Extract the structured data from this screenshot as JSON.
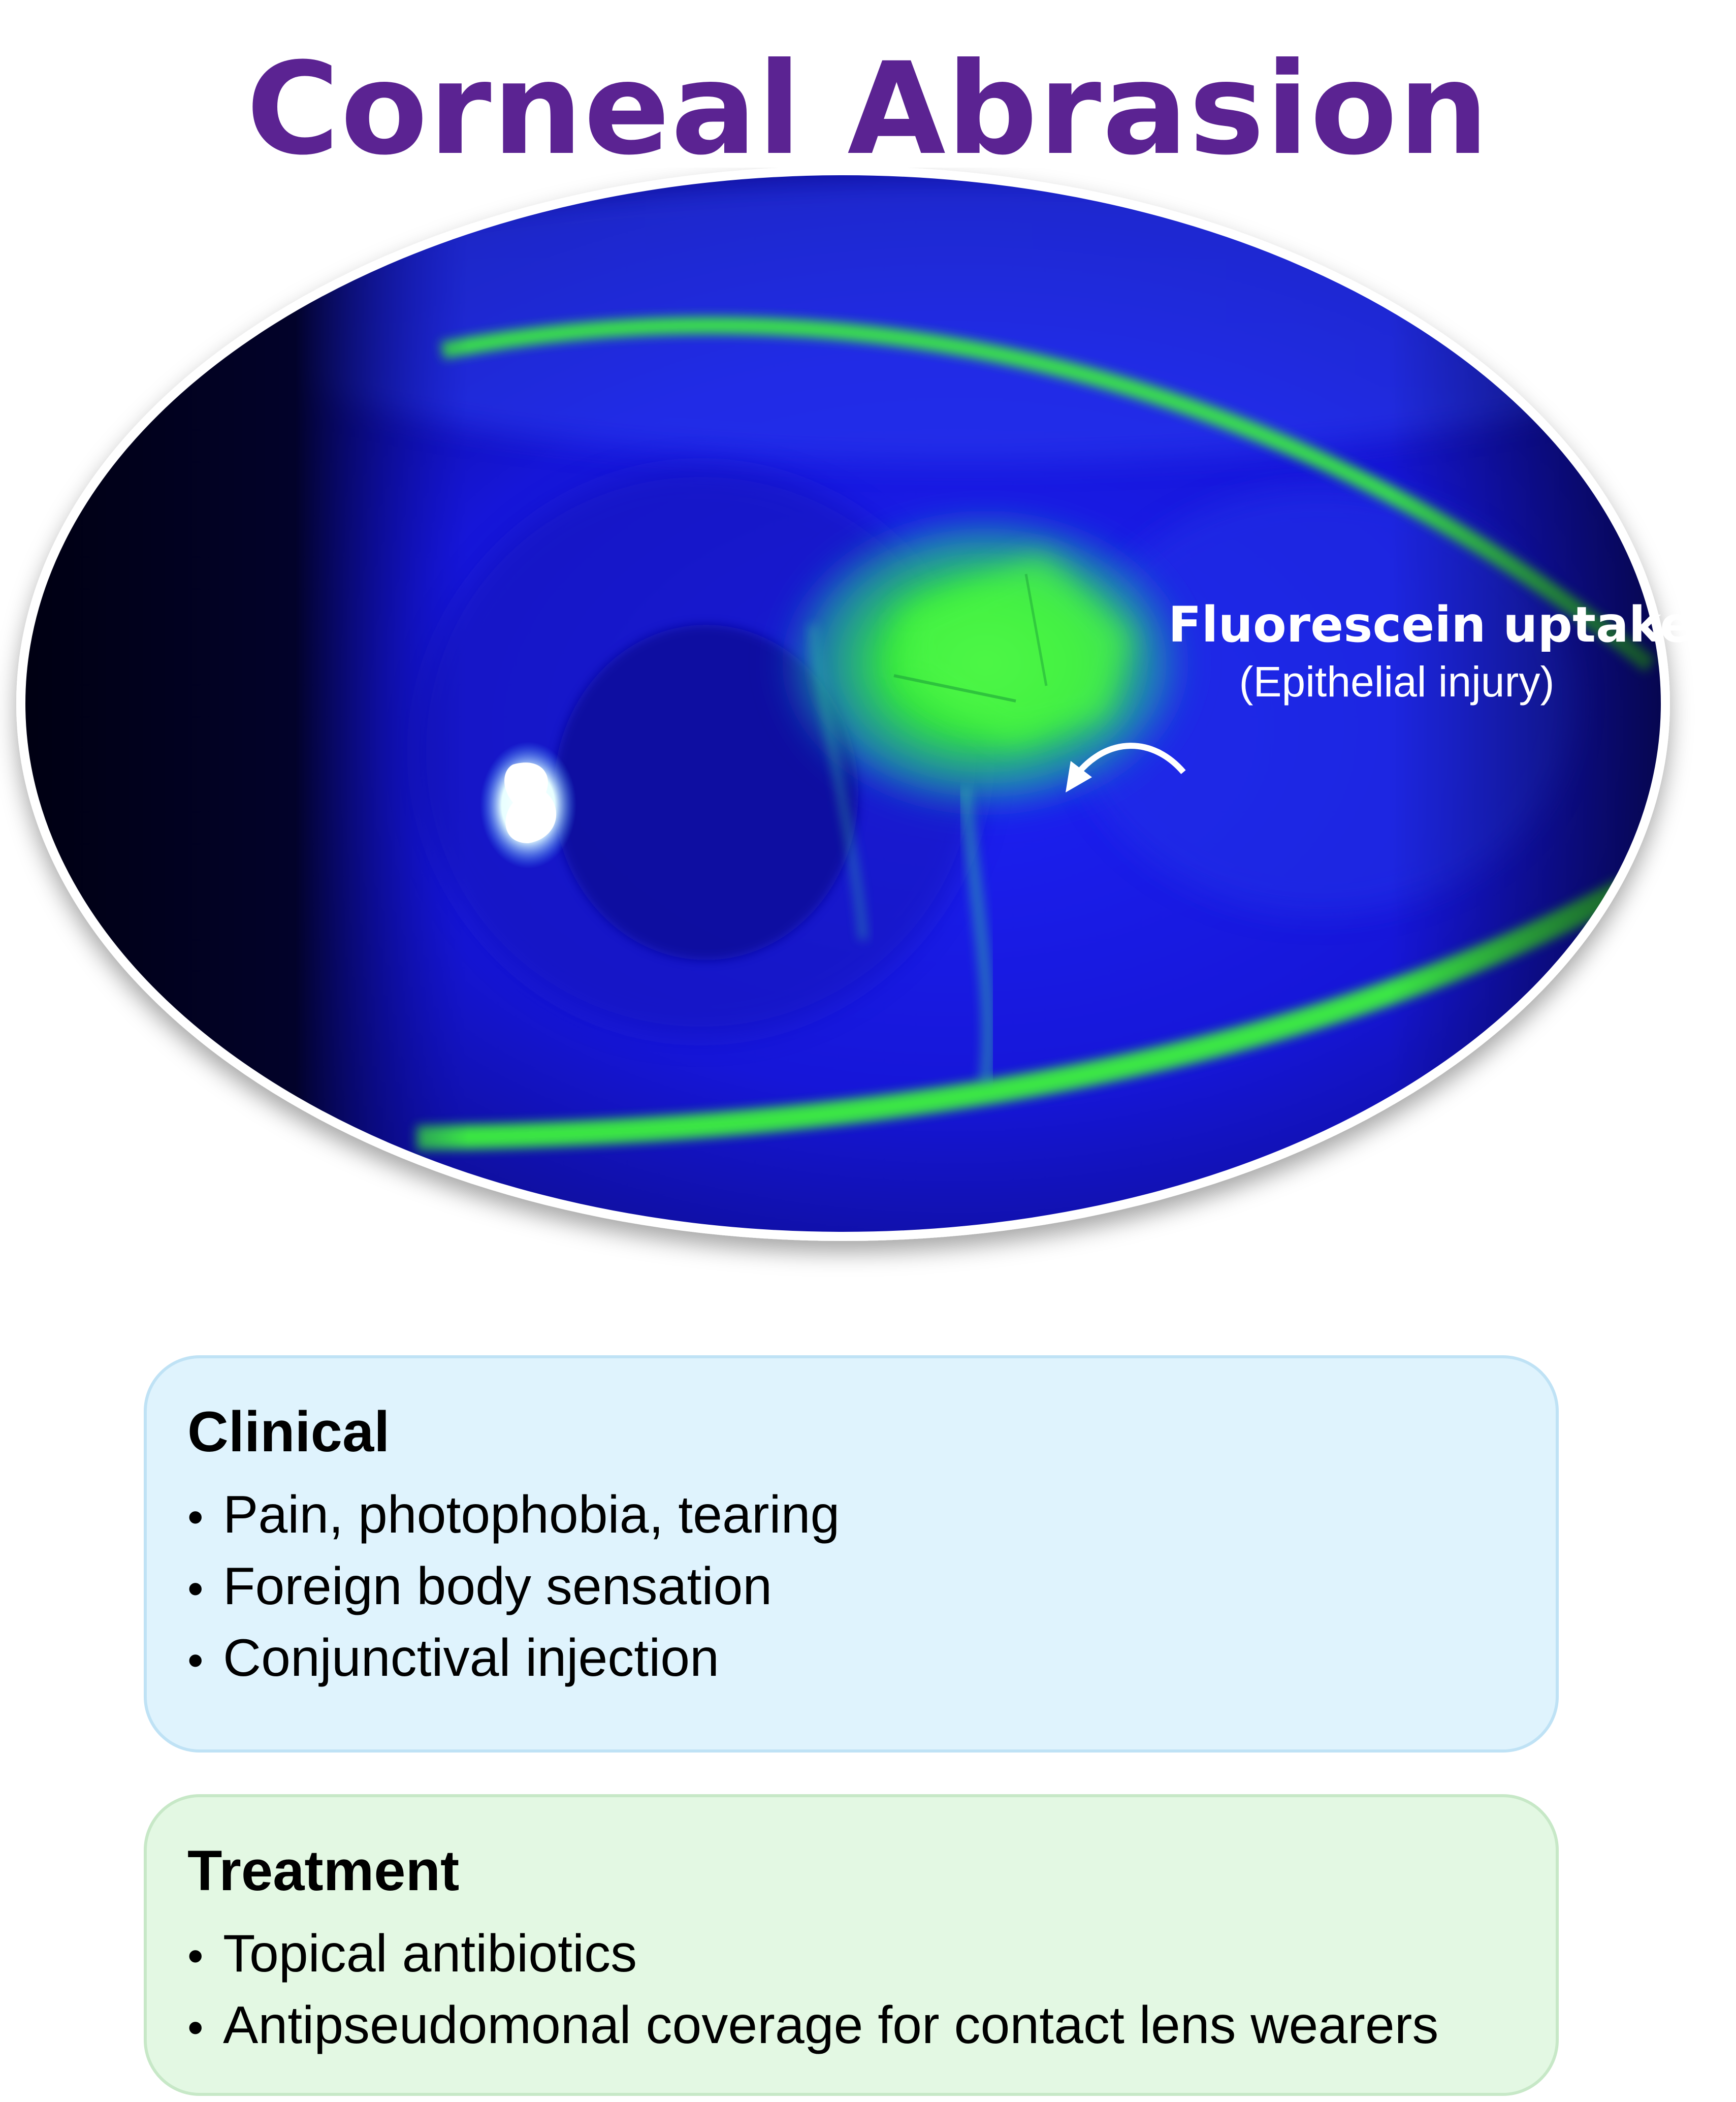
{
  "title": "Corneal Abrasion",
  "annotation": {
    "label": "Fluorescein uptake",
    "sublabel": "(Epithelial injury)"
  },
  "clinical": {
    "heading": "Clinical",
    "items": [
      "Pain, photophobia, tearing",
      "Foreign body sensation",
      "Conjunctival injection"
    ]
  },
  "treatment": {
    "heading": "Treatment",
    "items": [
      "Topical antibiotics",
      "Antipseudomonal coverage for contact lens wearers"
    ]
  },
  "colors": {
    "title": "#5b2392",
    "clinical_bg": "#dff3fd",
    "treatment_bg": "#e3f8e3",
    "fluorescein": "#39f23a",
    "cobalt_blue": "#1a1cf0"
  }
}
